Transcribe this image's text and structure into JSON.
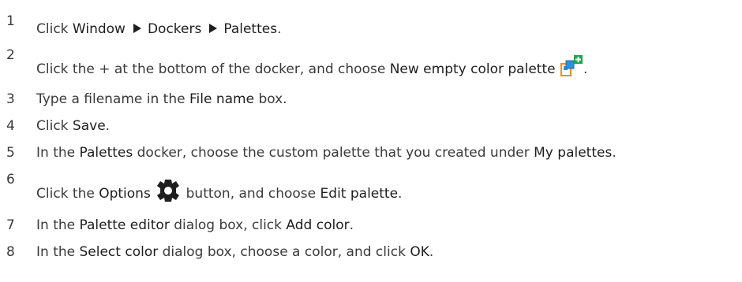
{
  "steps": [
    {
      "number": "1",
      "parts": {
        "a": "Click ",
        "b": "Window",
        "c": "Dockers",
        "d": "Palettes",
        "e": "."
      }
    },
    {
      "number": "2",
      "parts": {
        "a": "Click the + at the bottom of the docker, and choose ",
        "b": "New empty color palette",
        "c": "."
      },
      "icon": "new-palette-icon"
    },
    {
      "number": "3",
      "parts": {
        "a": "Type a filename in the ",
        "b": "File name",
        "c": " box."
      }
    },
    {
      "number": "4",
      "parts": {
        "a": "Click ",
        "b": "Save",
        "c": "."
      }
    },
    {
      "number": "5",
      "parts": {
        "a": "In the ",
        "b": "Palettes",
        "c": " docker, choose the custom palette that you created under ",
        "d": "My palettes",
        "e": "."
      }
    },
    {
      "number": "6",
      "parts": {
        "a": "Click the ",
        "b": "Options",
        "c": " button, and choose ",
        "d": "Edit palette",
        "e": "."
      },
      "icon": "gear-icon"
    },
    {
      "number": "7",
      "parts": {
        "a": "In the ",
        "b": "Palette editor",
        "c": " dialog box, click ",
        "d": "Add color",
        "e": "."
      }
    },
    {
      "number": "8",
      "parts": {
        "a": "In the ",
        "b": "Select color",
        "c": " dialog box, choose a color, and click ",
        "d": "OK",
        "e": "."
      }
    }
  ],
  "colors": {
    "text": "#3a3a3a",
    "ui_text": "#1e1e1e",
    "icon_blue": "#2f8fd8",
    "icon_orange": "#f08a24",
    "icon_green": "#1fa84f"
  }
}
